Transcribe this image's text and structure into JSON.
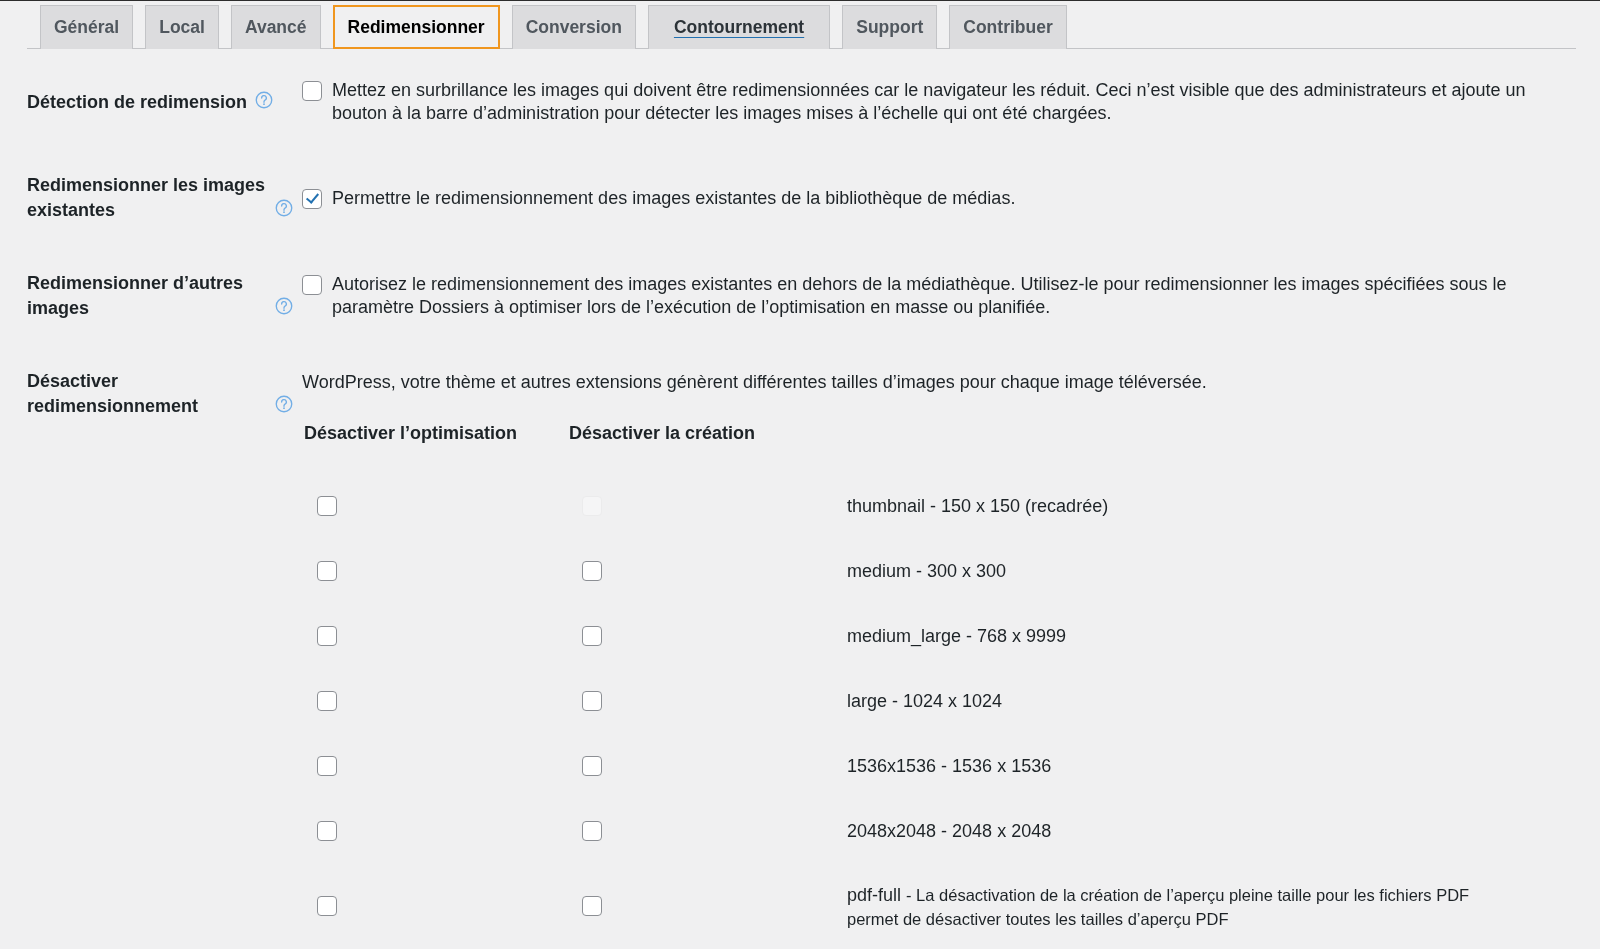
{
  "tabs": [
    {
      "label": "Général",
      "selected": false,
      "hovered": false
    },
    {
      "label": "Local",
      "selected": false,
      "hovered": false
    },
    {
      "label": "Avancé",
      "selected": false,
      "hovered": false
    },
    {
      "label": "Redimensionner",
      "selected": true,
      "hovered": false
    },
    {
      "label": "Conversion",
      "selected": false,
      "hovered": false
    },
    {
      "label": "Contournement",
      "selected": false,
      "hovered": true
    },
    {
      "label": "Support",
      "selected": false,
      "hovered": false
    },
    {
      "label": "Contribuer",
      "selected": false,
      "hovered": false
    }
  ],
  "settings": [
    {
      "kind": "checkbox",
      "label": "Détection de redimension",
      "checked": false,
      "description": "Mettez en surbrillance les images qui doivent être redimensionnées car le navigateur les réduit. Ceci n’est visible que des administrateurs et ajoute un bouton à la barre d’administration pour détecter les images mises à l’échelle qui ont été chargées."
    },
    {
      "kind": "checkbox",
      "label": "Redimensionner les images existantes",
      "checked": true,
      "description": "Permettre le redimensionnement des images existantes de la bibliothèque de médias."
    },
    {
      "kind": "checkbox",
      "label": "Redimensionner d’autres images",
      "checked": false,
      "description": "Autorisez le redimensionnement des images existantes en dehors de la médiathèque. Utilisez-le pour redimensionner les images spécifiées sous le paramètre Dossiers à optimiser lors de l’exécution de l’optimisation en masse ou planifiée."
    },
    {
      "kind": "sizes",
      "label": "Désactiver redimensionnement",
      "description": "WordPress, votre thème et autres extensions génèrent différentes tailles d’images pour chaque image téléversée.",
      "columns": [
        "Désactiver l’optimisation",
        "Désactiver la création"
      ],
      "sizes": [
        {
          "label": "thumbnail - 150 x 150 (recadrée)",
          "no_optimize": {
            "checked": false,
            "disabled": false
          },
          "no_create": {
            "checked": false,
            "disabled": true
          }
        },
        {
          "label": "medium - 300 x 300",
          "no_optimize": {
            "checked": false,
            "disabled": false
          },
          "no_create": {
            "checked": false,
            "disabled": false
          }
        },
        {
          "label": "medium_large - 768 x 9999",
          "no_optimize": {
            "checked": false,
            "disabled": false
          },
          "no_create": {
            "checked": false,
            "disabled": false
          }
        },
        {
          "label": "large - 1024 x 1024",
          "no_optimize": {
            "checked": false,
            "disabled": false
          },
          "no_create": {
            "checked": false,
            "disabled": false
          }
        },
        {
          "label": "1536x1536 - 1536 x 1536",
          "no_optimize": {
            "checked": false,
            "disabled": false
          },
          "no_create": {
            "checked": false,
            "disabled": false
          }
        },
        {
          "label": "2048x2048 - 2048 x 2048",
          "no_optimize": {
            "checked": false,
            "disabled": false
          },
          "no_create": {
            "checked": false,
            "disabled": false
          }
        },
        {
          "label": "pdf-full",
          "note": "- La désactivation de la création de l’aperçu pleine taille pour les fichiers PDF permet de désactiver toutes les tailles d’aperçu PDF",
          "no_optimize": {
            "checked": false,
            "disabled": false
          },
          "no_create": {
            "checked": false,
            "disabled": false
          }
        }
      ]
    }
  ]
}
